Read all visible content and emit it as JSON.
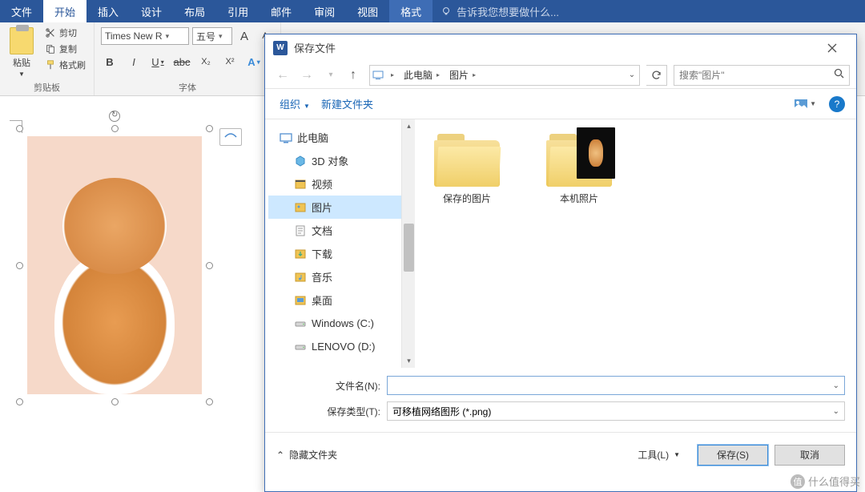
{
  "ribbon": {
    "tabs": [
      "文件",
      "开始",
      "插入",
      "设计",
      "布局",
      "引用",
      "邮件",
      "审阅",
      "视图",
      "格式"
    ],
    "active_index": 1,
    "tell_me": "告诉我您想要做什么...",
    "groups": {
      "clipboard": {
        "caption": "剪贴板",
        "paste": "粘贴",
        "cut": "剪切",
        "copy": "复制",
        "format_painter": "格式刷"
      },
      "font": {
        "caption": "字体",
        "family": "Times New R",
        "size": "五号",
        "grow": "A",
        "shrink": "A",
        "bold": "B",
        "italic": "I",
        "underline": "U",
        "strike": "abc",
        "subscript": "X₂",
        "superscript": "X²",
        "text_effects": "A"
      }
    }
  },
  "dialog": {
    "title": "保存文件",
    "breadcrumbs": [
      "此电脑",
      "图片"
    ],
    "search_placeholder": "搜索\"图片\"",
    "toolbar": {
      "organize": "组织",
      "new_folder": "新建文件夹"
    },
    "tree": [
      {
        "label": "此电脑",
        "icon": "pc",
        "level": 0
      },
      {
        "label": "3D 对象",
        "icon": "3d",
        "level": 1
      },
      {
        "label": "视频",
        "icon": "video",
        "level": 1
      },
      {
        "label": "图片",
        "icon": "pictures",
        "level": 1,
        "selected": true
      },
      {
        "label": "文档",
        "icon": "docs",
        "level": 1
      },
      {
        "label": "下载",
        "icon": "downloads",
        "level": 1
      },
      {
        "label": "音乐",
        "icon": "music",
        "level": 1
      },
      {
        "label": "桌面",
        "icon": "desktop",
        "level": 1
      },
      {
        "label": "Windows (C:)",
        "icon": "drive",
        "level": 1
      },
      {
        "label": "LENOVO (D:)",
        "icon": "drive",
        "level": 1
      }
    ],
    "files": [
      {
        "label": "保存的图片",
        "type": "folder"
      },
      {
        "label": "本机照片",
        "type": "folder-photo"
      }
    ],
    "filename_label": "文件名(N):",
    "filename_value": "",
    "filetype_label": "保存类型(T):",
    "filetype_value": "可移植网络图形 (*.png)",
    "hide_folders": "隐藏文件夹",
    "tools": "工具(L)",
    "save": "保存(S)",
    "cancel": "取消"
  },
  "watermark": "什么值得买"
}
